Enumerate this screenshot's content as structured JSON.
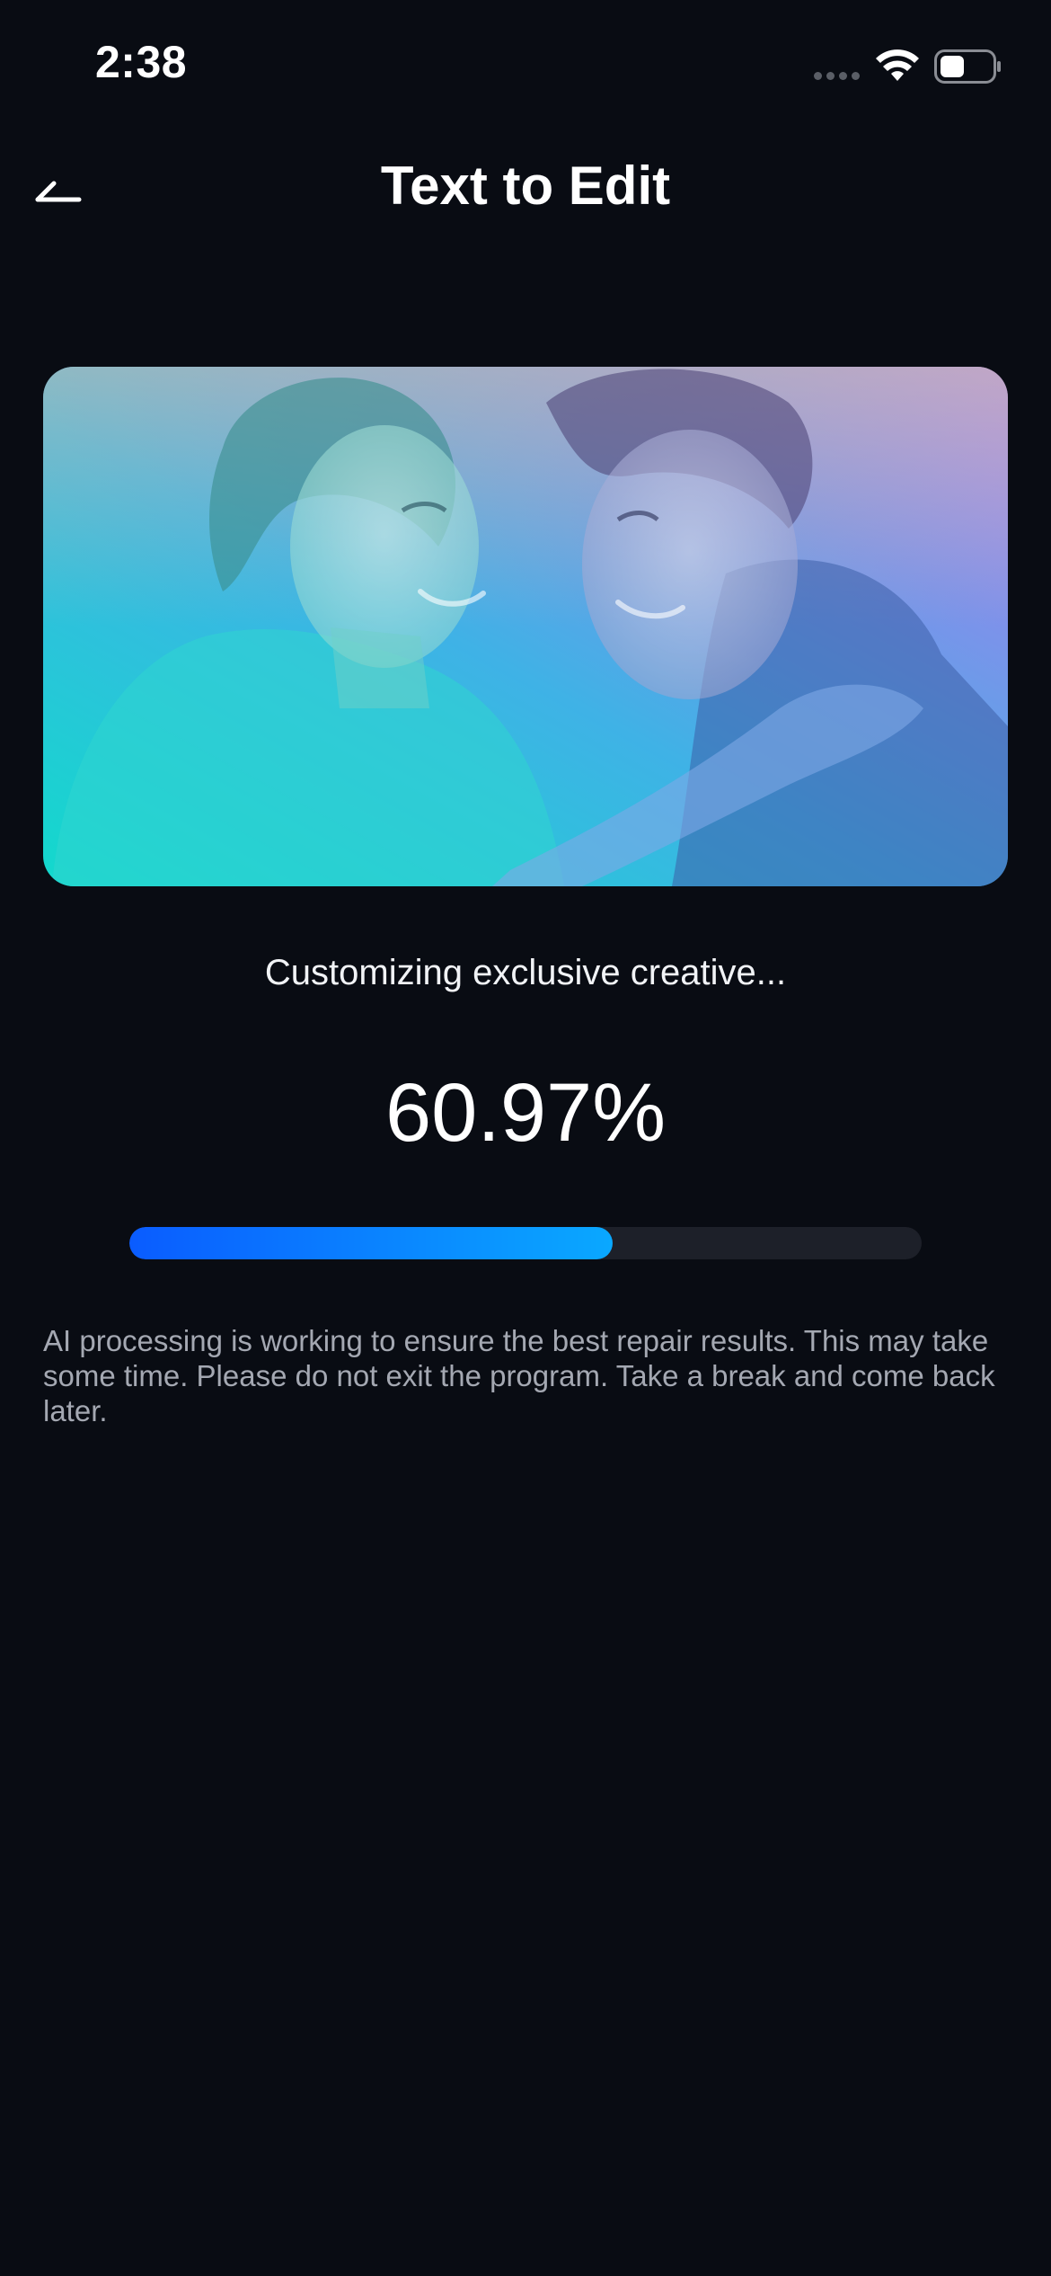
{
  "status_bar": {
    "time": "2:38",
    "icons": [
      "signal-icon",
      "wifi-icon",
      "battery-icon"
    ]
  },
  "header": {
    "title": "Text to Edit",
    "back_icon": "back-arrow-icon"
  },
  "main": {
    "status_message": "Customizing exclusive creative...",
    "progress_text": "60.97%",
    "progress_value": 0.6097,
    "info_text": "AI processing is working to ensure the best repair results. This may take some time. Please do not exit the program. Take a break and come back later."
  },
  "colors": {
    "background": "#090c13",
    "progress_start": "#0a5cff",
    "progress_end": "#0aa8ff",
    "progress_track": "#1d2029",
    "image_gradient_start": "#1de3d0",
    "image_gradient_end": "#b57ef0"
  }
}
